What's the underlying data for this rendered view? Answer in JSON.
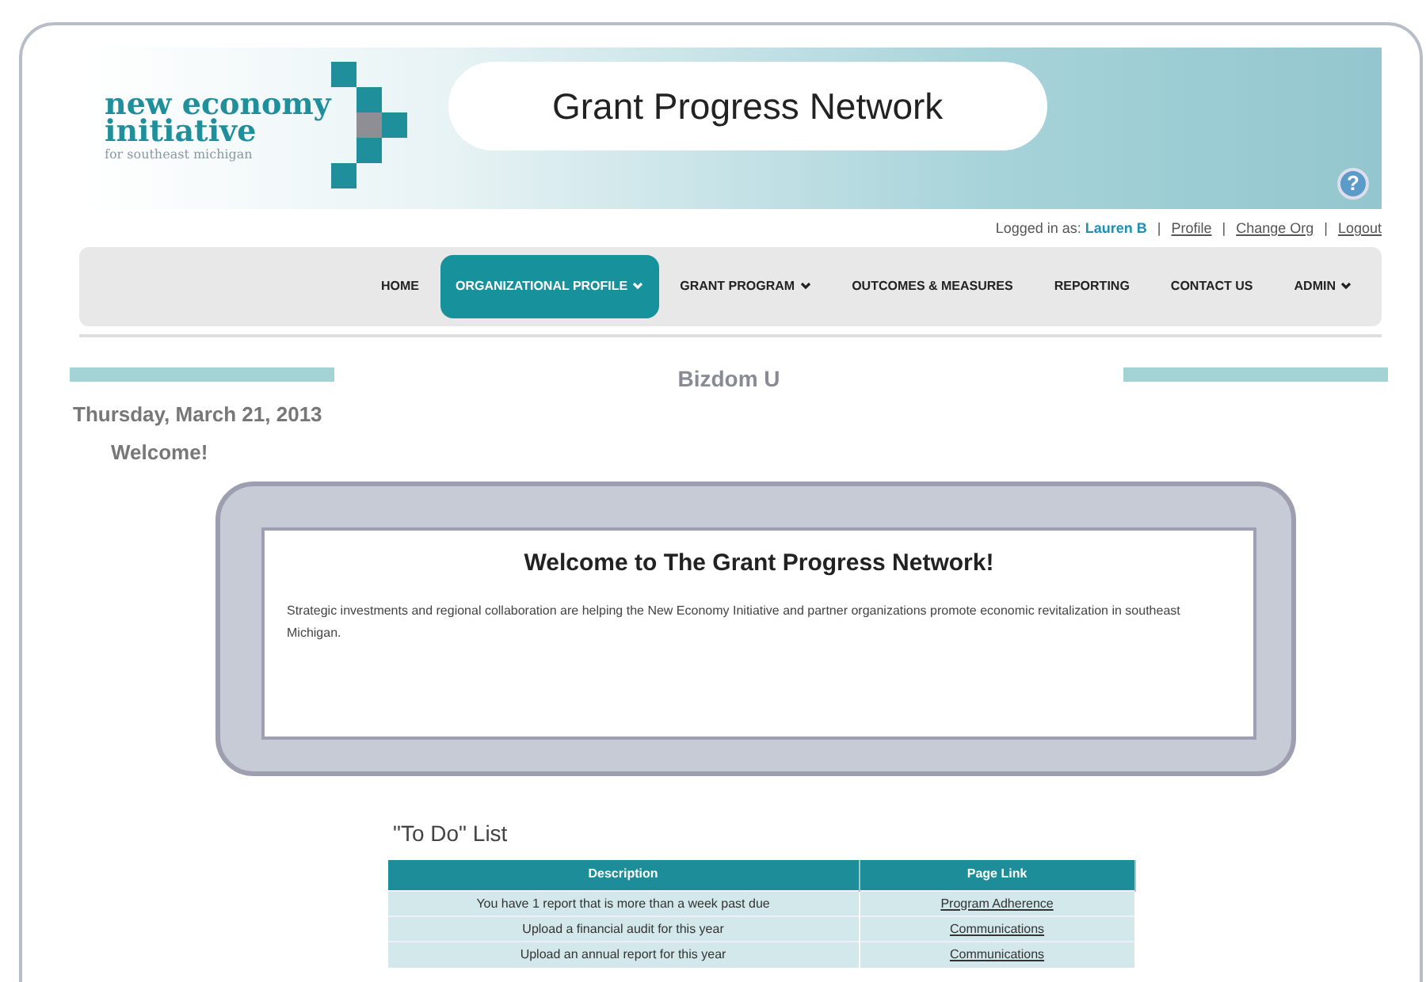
{
  "logo": {
    "line_1": "new economy",
    "line_2": "initiative",
    "tagline": "for southeast michigan"
  },
  "site_title": "Grant Progress Network",
  "help_icon": "?",
  "user_bar": {
    "prefix": "Logged in as:",
    "user": "Lauren B",
    "links": [
      "Profile",
      "Change Org",
      "Logout"
    ],
    "separator": "|"
  },
  "nav": [
    {
      "label": "HOME",
      "dropdown": false,
      "selected": false
    },
    {
      "label": "ORGANIZATIONAL PROFILE",
      "dropdown": true,
      "selected": true
    },
    {
      "label": "GRANT PROGRAM",
      "dropdown": true,
      "selected": false
    },
    {
      "label": "OUTCOMES & MEASURES",
      "dropdown": false,
      "selected": false
    },
    {
      "label": "REPORTING",
      "dropdown": false,
      "selected": false
    },
    {
      "label": "CONTACT US",
      "dropdown": false,
      "selected": false
    },
    {
      "label": "ADMIN",
      "dropdown": true,
      "selected": false
    }
  ],
  "org_name": "Bizdom U",
  "date": "Thursday, March 21, 2013",
  "greeting": "Welcome!",
  "welcome_panel": {
    "title": "Welcome to The Grant Progress Network!",
    "text": "Strategic investments and regional collaboration are helping the New Economy Initiative and partner organizations promote economic revitalization in southeast Michigan."
  },
  "todo": {
    "title": "\"To Do\" List",
    "columns": [
      "Description",
      "Page Link"
    ],
    "rows": [
      {
        "description": "You have 1 report that is more than a week past due",
        "link": "Program Adherence"
      },
      {
        "description": "Upload a financial audit for this year",
        "link": "Communications"
      },
      {
        "description": "Upload an annual report for this year",
        "link": "Communications"
      }
    ]
  }
}
